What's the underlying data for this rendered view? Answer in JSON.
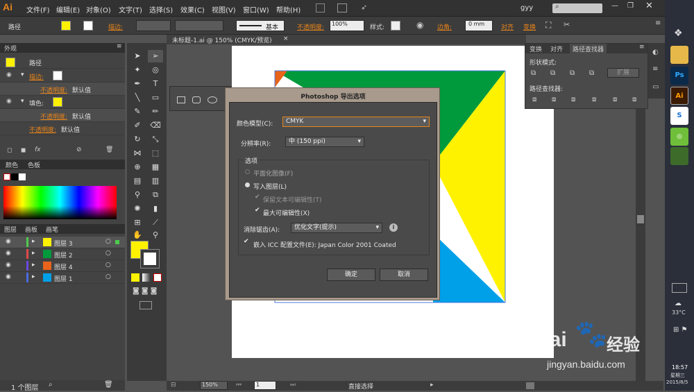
{
  "menubar": {
    "logo": "Ai",
    "items": [
      "文件(F)",
      "编辑(E)",
      "对象(O)",
      "文字(T)",
      "选择(S)",
      "效果(C)",
      "视图(V)",
      "窗口(W)",
      "帮助(H)"
    ],
    "user": "gyy"
  },
  "control": {
    "path_label": "路径",
    "stroke_label": "描边:",
    "stroke_style": "基本",
    "opacity_label": "不透明度:",
    "opacity_value": "100%",
    "style_label": "样式:",
    "corner_label": "边角:",
    "corner_value": "0 mm",
    "align_label": "对齐",
    "transform_label": "变换"
  },
  "appearance": {
    "tabs": [
      "外观"
    ],
    "path": "路径",
    "stroke": "描边:",
    "stroke_opacity_label": "不透明度:",
    "stroke_opacity_value": "默认值",
    "fill": "填色:",
    "fill_opacity_label": "不透明度:",
    "fill_opacity_value": "默认值",
    "opacity_label": "不透明度:",
    "opacity_value": "默认值"
  },
  "color_panel": {
    "tabs": [
      "颜色",
      "色板"
    ]
  },
  "layers_panel": {
    "tabs": [
      "图层",
      "画板",
      "画笔"
    ],
    "layers": [
      "图层 3",
      "图层 2",
      "图层 4",
      "图层 1"
    ],
    "footer": "1 个图层"
  },
  "doc_tab": {
    "title": "未标题-1.ai @ 150% (CMYK/预览)"
  },
  "pathfinder": {
    "tabs": [
      "变换",
      "对齐",
      "路径查找器"
    ],
    "shape_modes": "形状模式:",
    "expand": "扩展",
    "pathfinders": "路径查找器:"
  },
  "dialog": {
    "title": "Photoshop 导出选项",
    "color_model_label": "颜色模型(C):",
    "color_model_value": "CMYK",
    "resolution_label": "分辨率(R):",
    "resolution_value": "中 (150 ppi)",
    "options_label": "选项",
    "flat_image": "平面化图像(F)",
    "write_layers": "写入图层(L)",
    "preserve_text": "保留文本可编辑性(T)",
    "max_edit": "最大可编辑性(X)",
    "antialias_label": "消除锯齿(A):",
    "antialias_value": "优化文字(提示)",
    "embed_icc": "嵌入 ICC 配置文件(E): Japan Color 2001 Coated",
    "ok": "确定",
    "cancel": "取消"
  },
  "statusbar": {
    "zoom": "150%",
    "page": "1",
    "mode": "直接选择"
  },
  "taskbar": {
    "temp": "33°C",
    "time": "18:57",
    "weekday": "星期三",
    "date": "2015/8/5"
  },
  "watermark": {
    "brand": "Bai",
    "brand2": "经验",
    "url": "jingyan.baidu.com"
  },
  "colors": {
    "accent": "#e8841a",
    "green": "#009a3d",
    "yellow": "#fff200",
    "blue": "#00a0e9",
    "orange": "#e8641a",
    "dlgframe": "#a89a8c"
  }
}
